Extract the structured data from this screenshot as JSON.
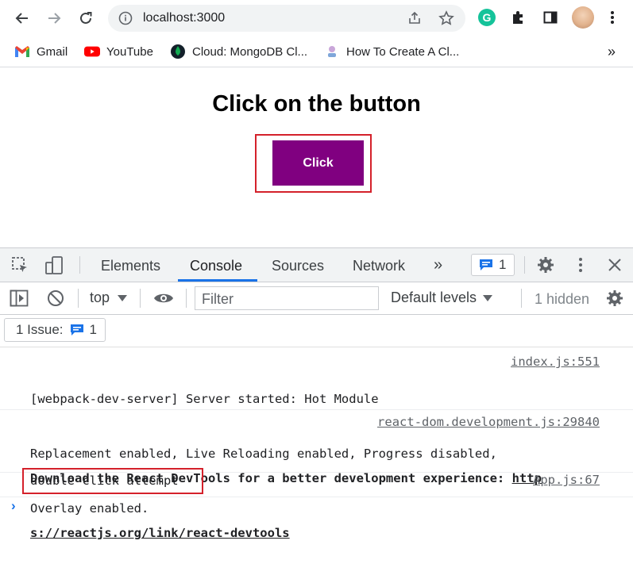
{
  "browser": {
    "url": "localhost:3000",
    "bookmarks": [
      {
        "label": "Gmail",
        "icon": "gmail-icon"
      },
      {
        "label": "YouTube",
        "icon": "youtube-icon"
      },
      {
        "label": "Cloud: MongoDB Cl...",
        "icon": "mongodb-icon"
      },
      {
        "label": "How To Create A Cl...",
        "icon": "bookmark-page-icon"
      }
    ],
    "more_bookmarks": "»",
    "grammarly_letter": "G"
  },
  "page": {
    "title": "Click on the button",
    "button_label": "Click"
  },
  "devtools": {
    "tabs": [
      "Elements",
      "Console",
      "Sources",
      "Network"
    ],
    "active_tab": "Console",
    "overflow": "»",
    "issues_badge_count": "1",
    "context": "top",
    "filter_placeholder": "Filter",
    "levels": "Default levels",
    "hidden": "1 hidden",
    "issue_label": "1 Issue:",
    "issue_count": "1",
    "messages": [
      {
        "text_line1": "[webpack-dev-server] Server started: Hot Module",
        "text_line2": "Replacement enabled, Live Reloading enabled, Progress disabled,",
        "text_line3": "Overlay enabled.",
        "source": "index.js:551"
      },
      {
        "source": "react-dom.development.js:29840",
        "text_line1": "Download the React DevTools for a better development experience: ",
        "link_part1": "http",
        "link_part2": "s://reactjs.org/link/react-devtools"
      },
      {
        "text_line1": "double click attempt",
        "source": "App.js:67"
      }
    ],
    "prompt": "›"
  },
  "colors": {
    "button_bg": "#800080",
    "highlight_red": "#d4212b",
    "devtools_accent": "#1a73e8"
  }
}
